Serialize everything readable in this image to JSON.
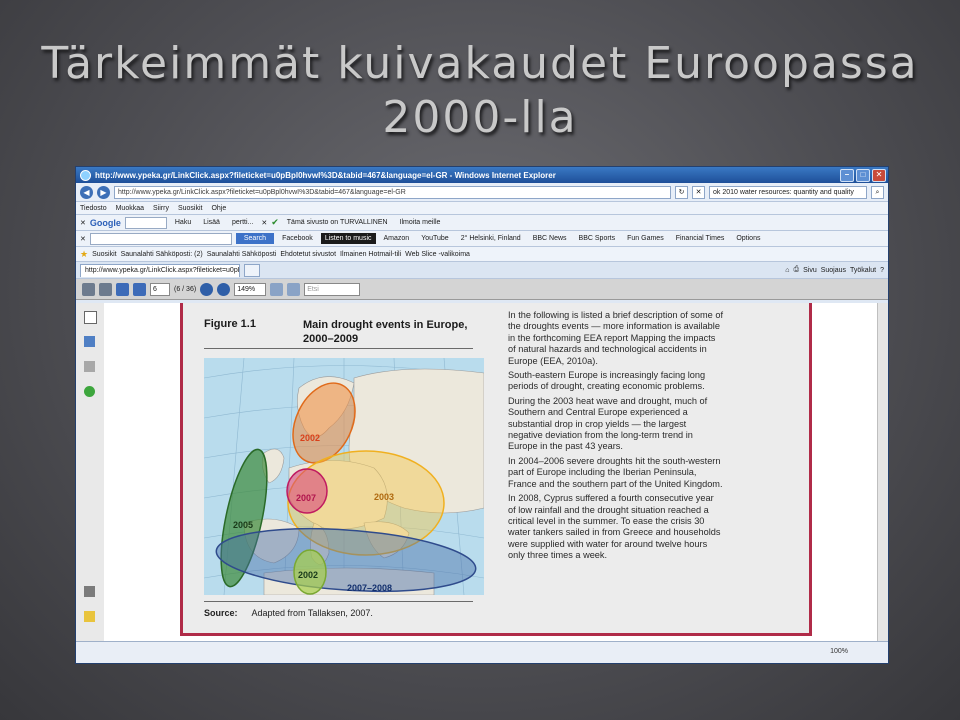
{
  "slide": {
    "title_line1": "Tärkeimmät kuivakaudet Euroopassa",
    "title_line2": "2000-lla"
  },
  "window": {
    "title": "http://www.ypeka.gr/LinkClick.aspx?fileticket=u0pBpl0hvwI%3D&tabid=467&language=el-GR - Windows Internet Explorer",
    "address": "http://www.ypeka.gr/LinkClick.aspx?fileticket=u0pBpl0hvwI%3D&tabid=467&language=el-GR",
    "search_value": "ok 2010 water resources: quantity and quality"
  },
  "menu": [
    "Tiedosto",
    "Muokkaa",
    "Siirry",
    "Suosikit",
    "Ohje"
  ],
  "toolbar1": {
    "google": "Google",
    "haku": "Haku",
    "lisaa": "Lisää",
    "user": "pertti...",
    "safe_text": "Tämä sivusto on TURVALLINEN",
    "report": "Ilmoita meille"
  },
  "toolbar2": {
    "search_btn": "Search",
    "items": [
      "Facebook",
      "Listen to music",
      "Amazon",
      "YouTube",
      "2° Helsinki, Finland",
      "BBC News",
      "BBC Sports",
      "Fun Games",
      "Financial Times",
      "Options"
    ]
  },
  "favorites": {
    "label": "Suosikit",
    "items": [
      "Saunalahti Sähköposti: (2)",
      "Saunalahti Sähköposti",
      "Ehdotetut sivustot",
      "Ilmainen Hotmail-tili",
      "Web Slice -valikoima"
    ]
  },
  "tab": {
    "label": "http://www.ypeka.gr/LinkClick.aspx?fileticket=u0pBpl...",
    "cmds": [
      "Sivu",
      "Suojaus",
      "Työkalut"
    ]
  },
  "pdf": {
    "page_input": "6",
    "page_count": "(6 / 36)",
    "zoom": "149%",
    "find_placeholder": "Etsi"
  },
  "figure": {
    "number": "Figure 1.1",
    "title": "Main drought events in Europe, 2000–2009",
    "source_label": "Source:",
    "source_text": "Adapted from Tallaksen, 2007.",
    "map_labels": {
      "e2002n": "2002",
      "e2003": "2003",
      "e2007": "2007",
      "e2005": "2005",
      "e2002s": "2002",
      "e2007_2008": "2007–2008"
    }
  },
  "body_text": [
    "In the following is listed a brief description of some of the droughts events — more information is available in the forthcoming EEA report Mapping the impacts of natural hazards and technological accidents in Europe (EEA, 2010a).",
    "South-eastern Europe is increasingly facing long periods of drought, creating economic problems.",
    "During the 2003 heat wave and drought, much of Southern and Central Europe experienced a substantial drop in crop yields — the largest negative deviation from the long-term trend in Europe in the past 43 years.",
    "In 2004–2006 severe droughts hit the south-western part of Europe including the Iberian Peninsula, France and the southern part of the United Kingdom.",
    "In 2008, Cyprus suffered a fourth consecutive year of low rainfall and the drought situation reached a critical level in the summer. To ease the crisis 30 water tankers sailed in from Greece and households were supplied with water for around twelve hours only three times a week."
  ],
  "status": {
    "zoom": "100%"
  },
  "colors": {
    "frame": "#b02b48",
    "e2002n": "#f08a3c",
    "e2003": "#f7c84a",
    "e2007": "#d63b7a",
    "e2005": "#3d8a3a",
    "e2002s": "#a6cf4a",
    "e2007_2008": "#2f4b8c"
  }
}
